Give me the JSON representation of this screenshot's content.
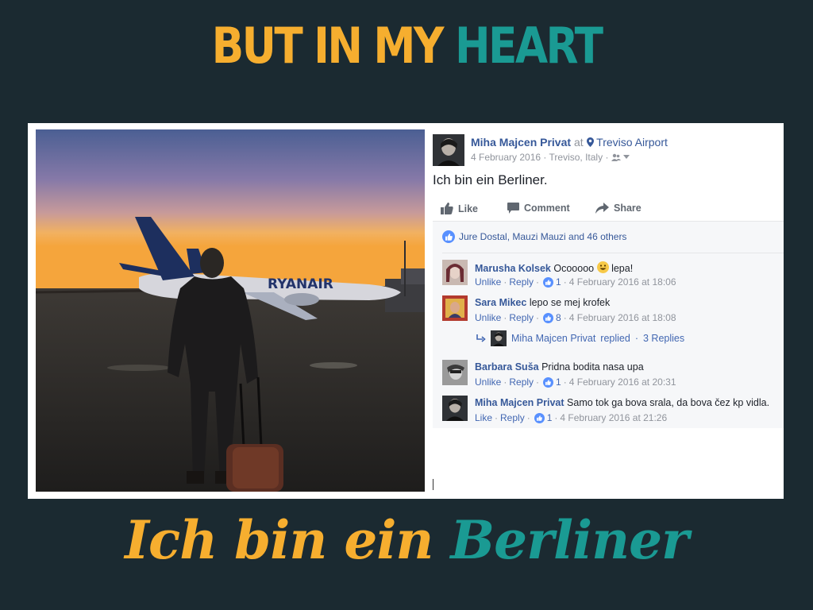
{
  "slide": {
    "top_title_part1": "BUT IN MY",
    "top_title_part2": "HEART",
    "bottom_title_part1": "Ich bin ein",
    "bottom_title_part2": "Berliner"
  },
  "colors": {
    "background": "#1b2a31",
    "yellow": "#f6ae2f",
    "teal": "#1a9a93",
    "facebook_link": "#365899"
  },
  "photo": {
    "tail_text": "RYANAIR"
  },
  "post": {
    "author": "Miha Majcen Privat",
    "at": "at",
    "location_icon": "map-pin-icon",
    "location": "Treviso Airport",
    "date": "4 February 2016",
    "place": "Treviso, Italy",
    "audience_icon": "friends-icon",
    "text": "Ich bin ein Berliner.",
    "actions": {
      "like": "Like",
      "comment": "Comment",
      "share": "Share"
    },
    "likes_summary": "Jure Dostal, Mauzi Mauzi and 46 others"
  },
  "comments": [
    {
      "name": "Marusha Kolsek",
      "text": "Ocooooo",
      "text_after_emoji": "lepa!",
      "emoji": "smile-emoji",
      "action": "Unlike",
      "reply": "Reply",
      "likes": "1",
      "date": "4 February 2016 at 18:06"
    },
    {
      "name": "Sara Mikec",
      "text": "lepo se mej krofek",
      "action": "Unlike",
      "reply": "Reply",
      "likes": "8",
      "date": "4 February 2016 at 18:08"
    },
    {
      "name": "Barbara Suša",
      "text": "Pridna bodita nasa upa",
      "action": "Unlike",
      "reply": "Reply",
      "likes": "1",
      "date": "4 February 2016 at 20:31"
    },
    {
      "name": "Miha Majcen Privat",
      "text": "Samo tok ga bova srala, da bova čez kp vidla.",
      "action": "Like",
      "reply": "Reply",
      "likes": "1",
      "date": "4 February 2016 at 21:26"
    }
  ],
  "replies_line": {
    "author": "Miha Majcen Privat",
    "text": "replied",
    "separator": "·",
    "count_text": "3 Replies"
  },
  "separator": "·"
}
